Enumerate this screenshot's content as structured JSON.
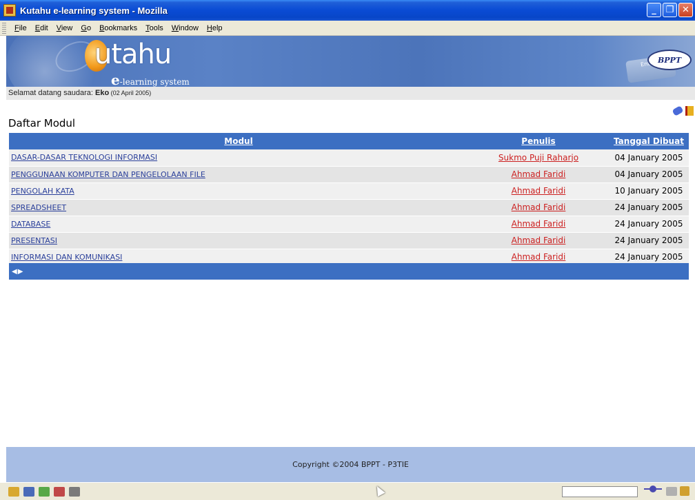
{
  "window": {
    "title": "Kutahu e-learning system - Mozilla",
    "min_glyph": "_",
    "max_glyph": "❐",
    "close_glyph": "✕"
  },
  "menu": [
    "File",
    "Edit",
    "View",
    "Go",
    "Bookmarks",
    "Tools",
    "Window",
    "Help"
  ],
  "banner": {
    "logo_text": "utahu",
    "logo_sub_e": "e",
    "logo_sub": "-learning system",
    "key_label": "Enter",
    "bppt": "BPPT"
  },
  "welcome": {
    "prefix": "Selamat datang saudara: ",
    "user": "Eko",
    "date": " (02 April 2005)"
  },
  "page": {
    "heading": "Daftar Modul"
  },
  "table": {
    "headers": {
      "modul": "Modul",
      "penulis": "Penulis",
      "tanggal": "Tanggal Dibuat"
    },
    "rows": [
      {
        "modul": "DASAR-DASAR TEKNOLOGI INFORMASI",
        "penulis": "Sukmo Puji Raharjo",
        "tanggal": "04 January 2005"
      },
      {
        "modul": "PENGGUNAAN KOMPUTER DAN PENGELOLAAN FILE",
        "penulis": "Ahmad Faridi",
        "tanggal": "04 January 2005"
      },
      {
        "modul": "PENGOLAH KATA",
        "penulis": "Ahmad Faridi",
        "tanggal": "10 January 2005"
      },
      {
        "modul": "SPREADSHEET",
        "penulis": "Ahmad Faridi",
        "tanggal": "24 January 2005"
      },
      {
        "modul": "DATABASE",
        "penulis": "Ahmad Faridi",
        "tanggal": "24 January 2005"
      },
      {
        "modul": "PRESENTASI",
        "penulis": "Ahmad Faridi",
        "tanggal": "24 January 2005"
      },
      {
        "modul": "INFORMASI DAN KOMUNIKASI",
        "penulis": "Ahmad Faridi",
        "tanggal": "24 January 2005"
      }
    ],
    "nav": "◀▶"
  },
  "footer": {
    "copyright": "Copyright ©2004 BPPT - P3TIE"
  }
}
